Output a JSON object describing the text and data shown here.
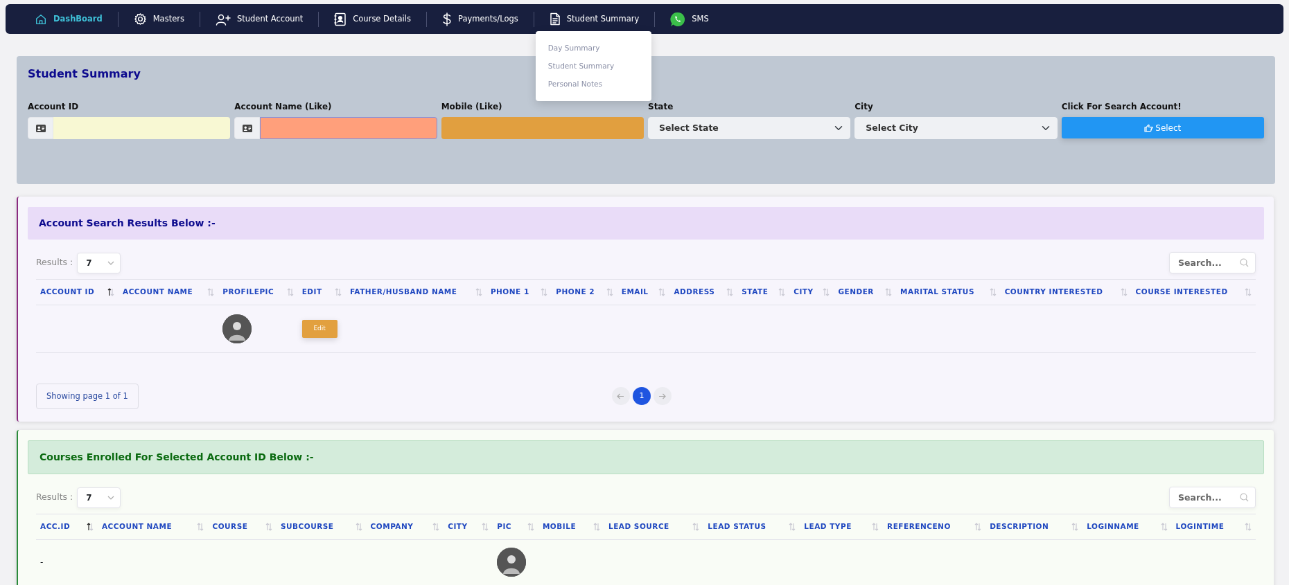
{
  "navbar": {
    "items": [
      {
        "label": "DashBoard",
        "active": true
      },
      {
        "label": "Masters",
        "active": false
      },
      {
        "label": "Student Account",
        "active": false
      },
      {
        "label": "Course Details",
        "active": false
      },
      {
        "label": "Payments/Logs",
        "active": false
      },
      {
        "label": "Student Summary",
        "active": false,
        "expanded": true
      },
      {
        "label": "SMS",
        "active": false
      }
    ]
  },
  "dropdown": {
    "items": [
      "Day Summary",
      "Student Summary",
      "Personal Notes"
    ]
  },
  "search_panel": {
    "title": "Student Summary",
    "fields": [
      {
        "kind": "icon_input",
        "label": "Account ID",
        "color": "#f8f8d3",
        "focused": false
      },
      {
        "kind": "icon_input",
        "label": "Account Name (Like)",
        "color": "#ff9f7b",
        "focused": true
      },
      {
        "kind": "input",
        "label": "Mobile (Like)",
        "color": "#e19f3f",
        "focused": false
      },
      {
        "kind": "select",
        "label": "State",
        "value": "Select State"
      },
      {
        "kind": "select",
        "label": "City",
        "value": "Select City"
      },
      {
        "kind": "button",
        "label": "Click For Search Account!",
        "button": "Select"
      }
    ]
  },
  "tables": [
    {
      "title": "Account Search Results Below :-",
      "results_label": "Results :",
      "page_size": "7",
      "search_placeholder": "Search...",
      "columns": [
        {
          "label": "ACCOUNT ID",
          "sorted": true
        },
        {
          "label": "ACCOUNT NAME",
          "sorted": false
        },
        {
          "label": "PROFILEPIC",
          "sorted": false
        },
        {
          "label": "EDIT",
          "sorted": false
        },
        {
          "label": "FATHER/HUSBAND NAME",
          "sorted": false
        },
        {
          "label": "PHONE 1",
          "sorted": false
        },
        {
          "label": "PHONE 2",
          "sorted": false
        },
        {
          "label": "EMAIL",
          "sorted": false
        },
        {
          "label": "ADDRESS",
          "sorted": false
        },
        {
          "label": "STATE",
          "sorted": false
        },
        {
          "label": "CITY",
          "sorted": false
        },
        {
          "label": "GENDER",
          "sorted": false
        },
        {
          "label": "MARITAL STATUS",
          "sorted": false
        },
        {
          "label": "COUNTRY INTERESTED",
          "sorted": false
        },
        {
          "label": "COURSE INTERESTED",
          "sorted": false
        }
      ],
      "rows": [
        {
          "cells": [
            {
              "kind": "empty"
            },
            {
              "kind": "empty"
            },
            {
              "kind": "avatar"
            },
            {
              "kind": "button",
              "text": "Edit"
            },
            {
              "kind": "empty"
            },
            {
              "kind": "empty"
            },
            {
              "kind": "empty"
            },
            {
              "kind": "empty"
            },
            {
              "kind": "empty"
            },
            {
              "kind": "empty"
            },
            {
              "kind": "empty"
            },
            {
              "kind": "empty"
            },
            {
              "kind": "empty"
            },
            {
              "kind": "empty"
            },
            {
              "kind": "empty"
            }
          ]
        }
      ],
      "pagination": {
        "info": "Showing page 1 of 1",
        "pages": [
          {
            "label": "1",
            "selected": true
          }
        ]
      }
    },
    {
      "title": "Courses Enrolled For Selected Account ID Below :-",
      "results_label": "Results :",
      "page_size": "7",
      "search_placeholder": "Search...",
      "columns": [
        {
          "label": "ACC.ID",
          "sorted": true
        },
        {
          "label": "ACCOUNT NAME",
          "sorted": false
        },
        {
          "label": "COURSE",
          "sorted": false
        },
        {
          "label": "SUBCOURSE",
          "sorted": false
        },
        {
          "label": "COMPANY",
          "sorted": false
        },
        {
          "label": "CITY",
          "sorted": false
        },
        {
          "label": "PIC",
          "sorted": false
        },
        {
          "label": "MOBILE",
          "sorted": false
        },
        {
          "label": "LEAD SOURCE",
          "sorted": false
        },
        {
          "label": "LEAD STATUS",
          "sorted": false
        },
        {
          "label": "LEAD TYPE",
          "sorted": false
        },
        {
          "label": "REFERENCENO",
          "sorted": false
        },
        {
          "label": "DESCRIPTION",
          "sorted": false
        },
        {
          "label": "LOGINNAME",
          "sorted": false
        },
        {
          "label": "LOGINTIME",
          "sorted": false
        }
      ],
      "rows": [
        {
          "cells": [
            {
              "kind": "text",
              "text": "-"
            },
            {
              "kind": "empty"
            },
            {
              "kind": "empty"
            },
            {
              "kind": "empty"
            },
            {
              "kind": "empty"
            },
            {
              "kind": "empty"
            },
            {
              "kind": "avatar"
            },
            {
              "kind": "empty"
            },
            {
              "kind": "empty"
            },
            {
              "kind": "empty"
            },
            {
              "kind": "empty"
            },
            {
              "kind": "empty"
            },
            {
              "kind": "empty"
            },
            {
              "kind": "empty"
            },
            {
              "kind": "empty"
            }
          ]
        }
      ]
    }
  ]
}
